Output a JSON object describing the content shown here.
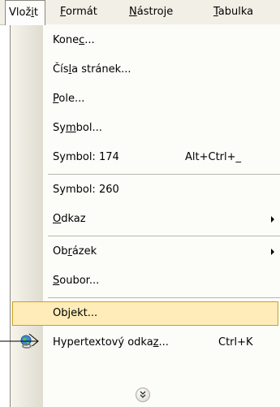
{
  "menubar": {
    "items": [
      {
        "pre": "Vlož",
        "key": "i",
        "post": "t",
        "active": true
      },
      {
        "pre": "",
        "key": "F",
        "post": "ormát",
        "active": false
      },
      {
        "pre": "",
        "key": "N",
        "post": "ástroje",
        "active": false
      },
      {
        "pre": "",
        "key": "T",
        "post": "abulka",
        "active": false
      }
    ]
  },
  "menu": {
    "items": [
      {
        "pre": "Kone",
        "key": "c",
        "post": "...",
        "shortcut": "",
        "submenu": false,
        "icon": ""
      },
      {
        "pre": "Čís",
        "key": "l",
        "post": "a stránek...",
        "shortcut": "",
        "submenu": false,
        "icon": ""
      },
      {
        "pre": "",
        "key": "P",
        "post": "ole...",
        "shortcut": "",
        "submenu": false,
        "icon": ""
      },
      {
        "pre": "Sy",
        "key": "m",
        "post": "bol...",
        "shortcut": "",
        "submenu": false,
        "icon": ""
      },
      {
        "pre": "Symbol: 174",
        "key": "",
        "post": "",
        "shortcut": "Alt+Ctrl+_",
        "submenu": false,
        "icon": ""
      },
      {
        "pre": "Symbol: 260",
        "key": "",
        "post": "",
        "shortcut": "",
        "submenu": false,
        "icon": ""
      },
      {
        "pre": "",
        "key": "O",
        "post": "dkaz",
        "shortcut": "",
        "submenu": true,
        "icon": ""
      },
      {
        "pre": "Ob",
        "key": "r",
        "post": "ázek",
        "shortcut": "",
        "submenu": true,
        "icon": ""
      },
      {
        "pre": "",
        "key": "S",
        "post": "oubor...",
        "shortcut": "",
        "submenu": false,
        "icon": ""
      },
      {
        "pre": "Ob",
        "key": "j",
        "post": "ekt...",
        "shortcut": "",
        "submenu": false,
        "icon": "",
        "highlighted": true
      },
      {
        "pre": "Hypertextový odka",
        "key": "z",
        "post": "...",
        "shortcut": "Ctrl+K",
        "submenu": false,
        "icon": "globe-link-icon"
      }
    ],
    "expand_icon": "double-chevron-down-icon"
  },
  "colors": {
    "highlight_fill": "#ffecb8",
    "highlight_border": "#c9a227",
    "menubar_bg": "#f2efe6"
  }
}
